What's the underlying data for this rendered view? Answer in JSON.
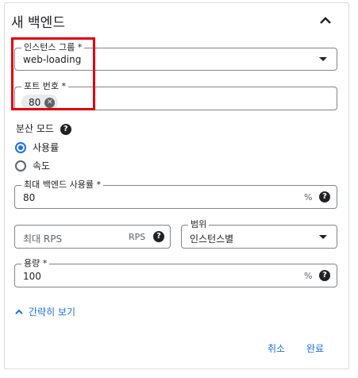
{
  "header": {
    "title": "새 백엔드",
    "collapse_icon": "chevron-up-icon"
  },
  "instance_group": {
    "label": "인스턴스 그룹 *",
    "value": "web-loading"
  },
  "port_numbers": {
    "label": "포트 번호 *",
    "chips": [
      "80"
    ]
  },
  "balancing_mode": {
    "label": "분산 모드",
    "options": [
      {
        "label": "사용률",
        "checked": true
      },
      {
        "label": "속도",
        "checked": false
      }
    ]
  },
  "max_utilization": {
    "label": "최대 백엔드 사용률 *",
    "value": "80",
    "suffix": "%"
  },
  "max_rps": {
    "placeholder": "최대 RPS",
    "suffix": "RPS"
  },
  "scope": {
    "label": "범위",
    "value": "인스턴스별"
  },
  "capacity": {
    "label": "용량 *",
    "value": "100",
    "suffix": "%"
  },
  "toggle_link": {
    "label": "간략히 보기"
  },
  "actions": {
    "cancel": "취소",
    "done": "완료"
  },
  "colors": {
    "accent": "#1a73e8",
    "highlight": "#e0000f",
    "border": "#80868b"
  }
}
